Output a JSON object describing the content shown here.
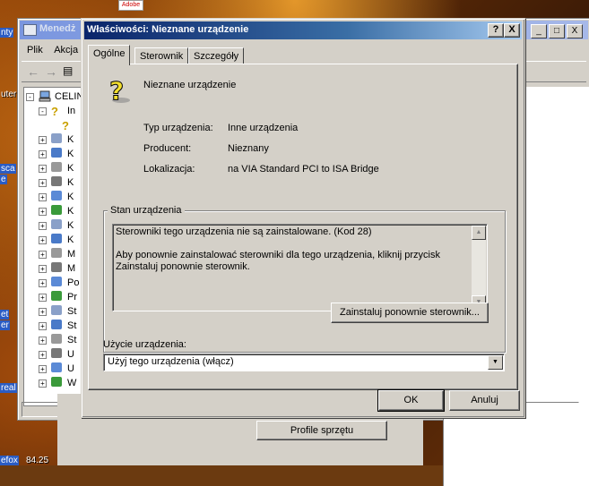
{
  "desktop": {
    "labels": [
      "nty",
      "uter",
      "sca",
      "e",
      "et",
      "er",
      "real",
      "efox",
      "84.25"
    ],
    "top_icon_text": "Adobe"
  },
  "device_manager": {
    "title": "Menedż",
    "menu": [
      "Plik",
      "Akcja"
    ],
    "tree_root": "CELIN",
    "tree_rows": [
      "In",
      "",
      "K",
      "K",
      "K",
      "K",
      "K",
      "K",
      "K",
      "K",
      "M",
      "M",
      "Po",
      "Pr",
      "St",
      "St",
      "St",
      "U",
      "U",
      "W"
    ],
    "profile_button": "Profile sprzętu",
    "controls": [
      "_",
      "□",
      "X"
    ]
  },
  "dialog": {
    "title": "Właściwości: Nieznane urządzenie",
    "help_button": "?",
    "close_button": "X",
    "tabs": [
      "Ogólne",
      "Sterownik",
      "Szczegóły"
    ],
    "active_tab": 0,
    "device_name": "Nieznane urządzenie",
    "properties": [
      {
        "label": "Typ urządzenia:",
        "value": "Inne urządzenia"
      },
      {
        "label": "Producent:",
        "value": "Nieznany"
      },
      {
        "label": "Lokalizacja:",
        "value": "na VIA Standard PCI to ISA Bridge"
      }
    ],
    "status_group_title": "Stan urządzenia",
    "status_text": [
      "Sterowniki tego urządzenia nie są zainstalowane. (Kod 28)",
      "Aby ponownie zainstalować sterowniki dla tego urządzenia, kliknij przycisk Zainstaluj ponownie sterownik."
    ],
    "reinstall_button": "Zainstaluj ponownie sterownik...",
    "usage_label": "Użycie urządzenia:",
    "usage_value": "Użyj tego urządzenia (włącz)",
    "ok_button": "OK",
    "cancel_button": "Anuluj"
  }
}
